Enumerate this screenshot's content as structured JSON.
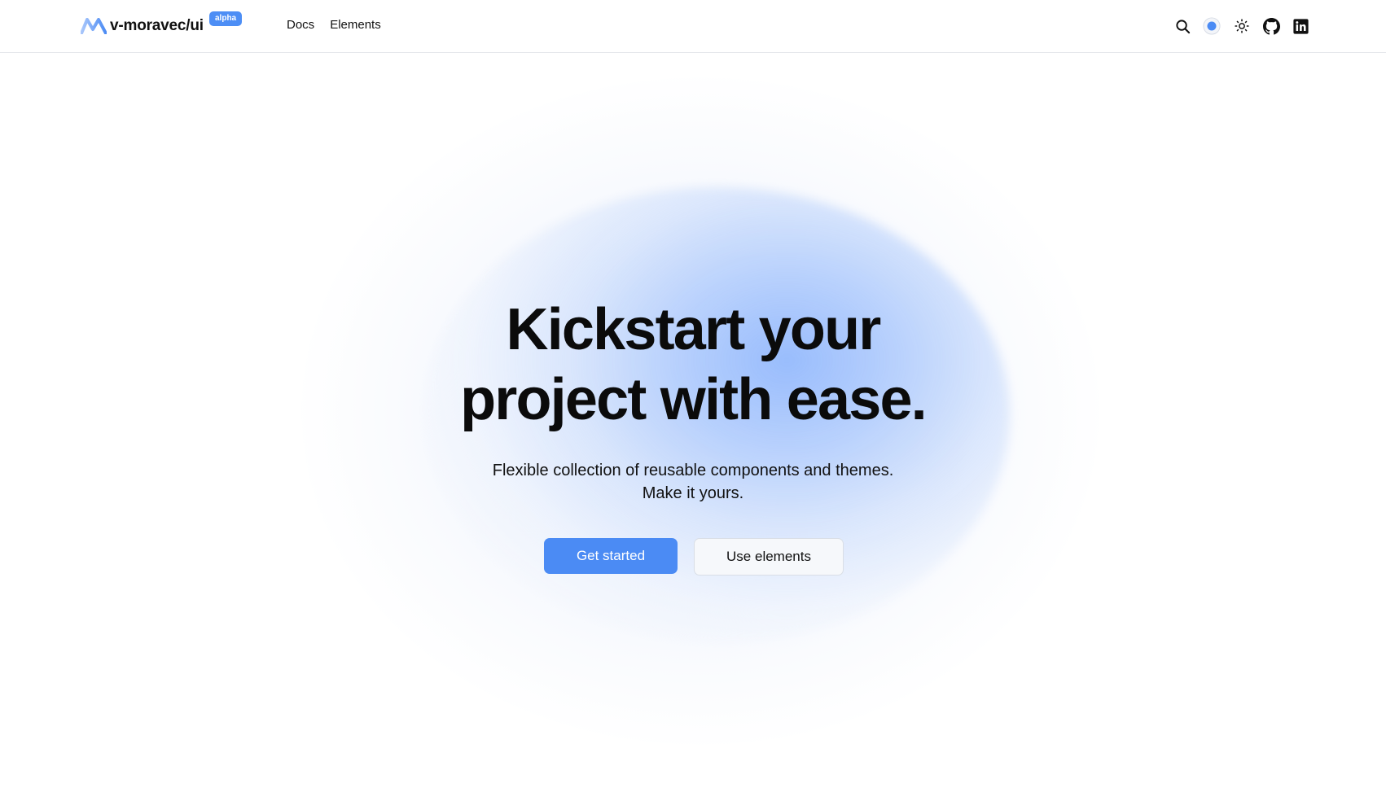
{
  "header": {
    "brand_name": "v-moravec/ui",
    "badge": "alpha",
    "nav": [
      {
        "label": "Docs"
      },
      {
        "label": "Elements"
      }
    ],
    "tools": [
      {
        "icon": "search-icon"
      },
      {
        "icon": "theme-color-icon"
      },
      {
        "icon": "sun-icon"
      },
      {
        "icon": "github-icon"
      },
      {
        "icon": "linkedin-icon"
      }
    ]
  },
  "hero": {
    "headline_line1": "Kickstart your",
    "headline_line2": "project with ease.",
    "subtitle_line1": "Flexible collection of reusable components and themes.",
    "subtitle_line2": "Make it yours.",
    "primary_cta": "Get started",
    "secondary_cta": "Use elements"
  },
  "colors": {
    "accent": "#4b8bf4",
    "badge": "#4d8ef5",
    "glow": "#89b2fc",
    "text": "#0b0b0b"
  }
}
